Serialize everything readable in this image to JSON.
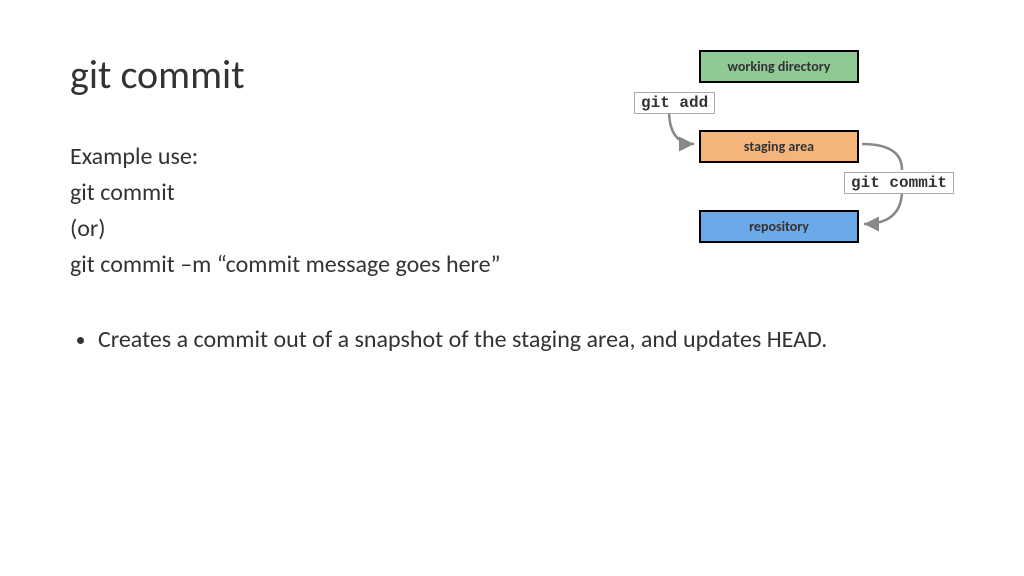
{
  "title": "git commit",
  "example": {
    "heading": "Example use:",
    "line1": "git commit",
    "or": "(or)",
    "line2": "git commit –m “commit message goes here”"
  },
  "bullet": "Creates a commit out of a snapshot of the staging area, and updates HEAD.",
  "diagram": {
    "working": "working directory",
    "staging": "staging area",
    "repo": "repository",
    "add_cmd": "git add",
    "commit_cmd": "git commit"
  }
}
